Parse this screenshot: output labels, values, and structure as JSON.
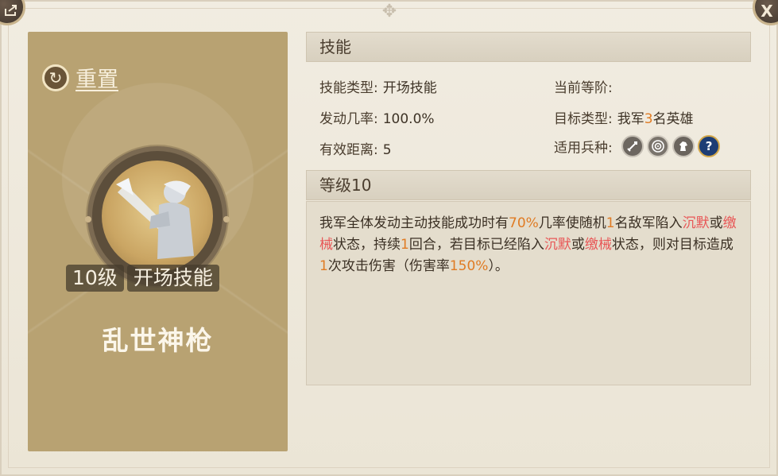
{
  "header": {
    "back_icon": "share-out-icon",
    "close_label": "X"
  },
  "card": {
    "reset_label": "重置",
    "level_badge": "10级",
    "skill_type_badge": "开场技能",
    "skill_name": "乱世神枪"
  },
  "skill_section": {
    "title": "技能",
    "type_label": "技能类型:",
    "type_value": "开场技能",
    "rank_label": "当前等阶:",
    "rank_value": "",
    "rate_label": "发动几率:",
    "rate_value": "100.0%",
    "target_label": "目标类型:",
    "target_prefix": "我军",
    "target_count": "3",
    "target_suffix": "名英雄",
    "range_label": "有效距离:",
    "range_value": "5",
    "troop_label": "适用兵种:",
    "troops": [
      "sword-icon",
      "bow-icon",
      "horse-icon",
      "question-icon"
    ],
    "troop_unknown_glyph": "?"
  },
  "level_section": {
    "title": "等级10",
    "desc": {
      "p1": "我军全体发动主动技能成功时有",
      "chance": "70%",
      "p2": "几率使随机",
      "count": "1",
      "p3": "名敌军陷入",
      "silence1": "沉默",
      "or1": "或",
      "disarm1": "缴械",
      "p4": "状态，持续",
      "turns": "1",
      "p5": "回合，若目标已经陷入",
      "silence2": "沉默",
      "or2": "或",
      "disarm2": "缴械",
      "p6": "状态，则对目标造成",
      "hits": "1",
      "p7": "次攻击伤害（伤害率",
      "dmg_rate": "150%",
      "p8": "）。"
    }
  },
  "colors": {
    "highlight_orange": "#e07b23",
    "highlight_red": "#e85656",
    "card_bg": "#b8a272"
  }
}
